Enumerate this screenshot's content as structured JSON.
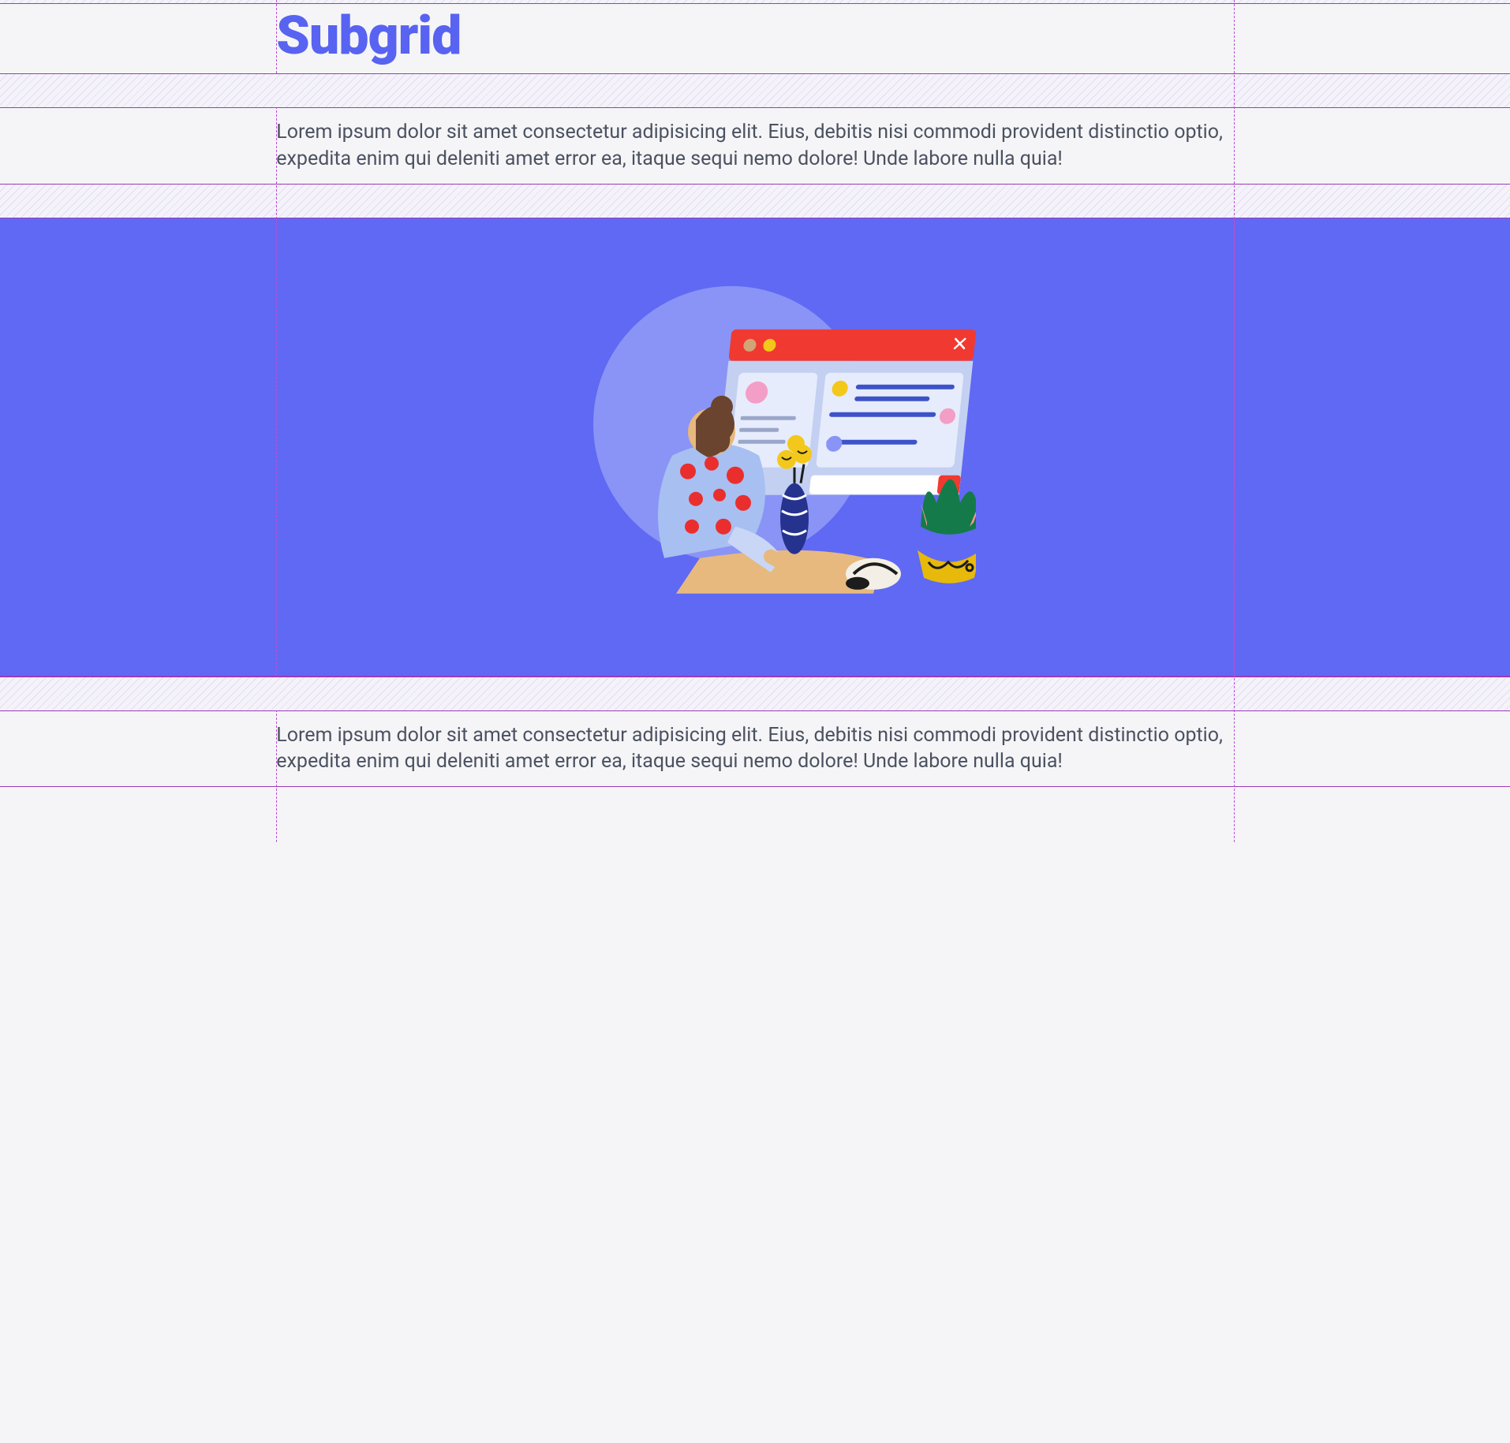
{
  "heading": "Subgrid",
  "para_top": "Lorem ipsum dolor sit amet consectetur adipisicing elit. Eius, debitis nisi commodi provident distinctio optio, expedita enim qui deleniti amet error ea, itaque sequi nemo dolore! Unde labore nulla quia!",
  "para_bottom": "Lorem ipsum dolor sit amet consectetur adipisicing elit. Eius, debitis nisi commodi provident distinctio optio, expedita enim qui deleniti amet error ea, itaque sequi nemo dolore! Unde labore nulla quia!",
  "illustration": {
    "name": "person-with-laptop-and-plant-illustration",
    "bg_color": "#6069f3"
  },
  "colors": {
    "accent": "#5863f1",
    "grid_line": "#9c3ab8"
  }
}
